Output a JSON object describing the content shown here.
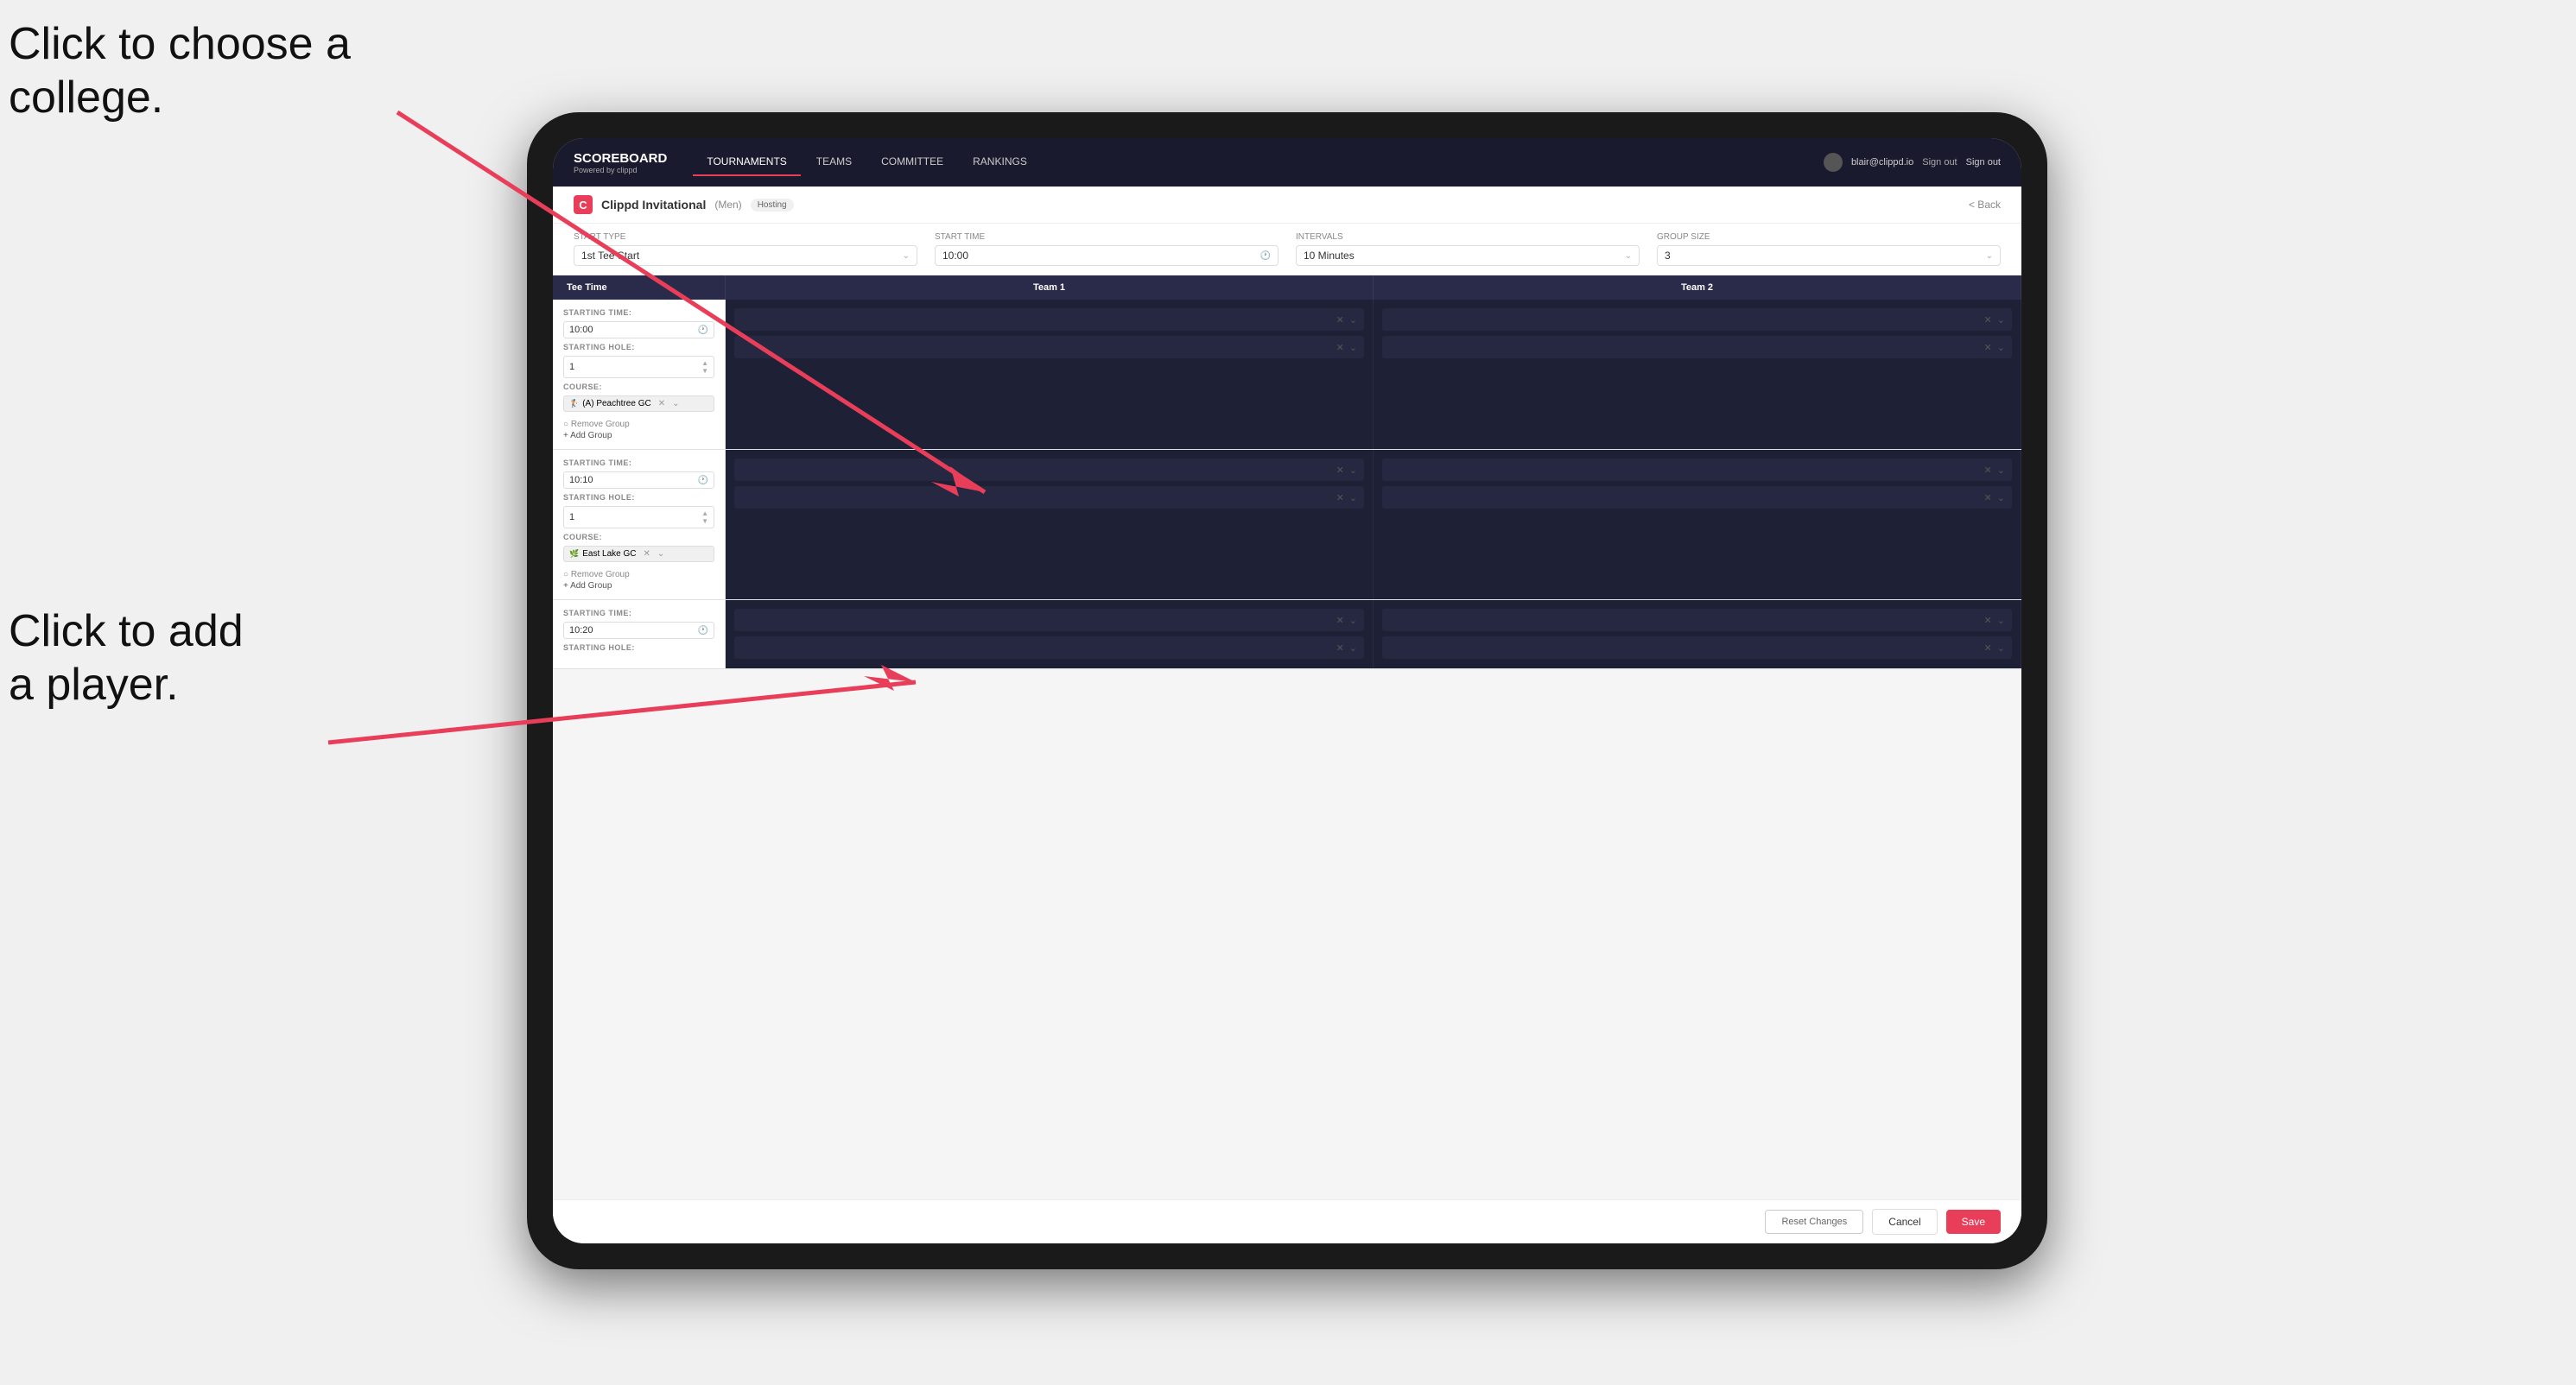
{
  "annotations": {
    "top": "Click to choose a\ncollege.",
    "bottom": "Click to add\na player."
  },
  "nav": {
    "logo": "SCOREBOARD",
    "powered_by": "Powered by clippd",
    "tabs": [
      {
        "label": "TOURNAMENTS",
        "active": true
      },
      {
        "label": "TEAMS",
        "active": false
      },
      {
        "label": "COMMITTEE",
        "active": false
      },
      {
        "label": "RANKINGS",
        "active": false
      }
    ],
    "user_email": "blair@clippd.io",
    "sign_out": "Sign out"
  },
  "page": {
    "tournament_name": "Clippd Invitational",
    "gender": "(Men)",
    "hosting_label": "Hosting",
    "back_label": "< Back"
  },
  "controls": {
    "start_type_label": "Start Type",
    "start_type_value": "1st Tee Start",
    "start_time_label": "Start Time",
    "start_time_value": "10:00",
    "intervals_label": "Intervals",
    "intervals_value": "10 Minutes",
    "group_size_label": "Group Size",
    "group_size_value": "3"
  },
  "table": {
    "tee_time_header": "Tee Time",
    "team1_header": "Team 1",
    "team2_header": "Team 2"
  },
  "groups": [
    {
      "starting_time": "10:00",
      "starting_hole": "1",
      "course": "(A) Peachtree GC",
      "course_icon": "🏌",
      "team1_players": 2,
      "team2_players": 2
    },
    {
      "starting_time": "10:10",
      "starting_hole": "1",
      "course": "East Lake GC",
      "course_icon": "🌿",
      "team1_players": 2,
      "team2_players": 2
    },
    {
      "starting_time": "10:20",
      "starting_hole": "",
      "course": "",
      "course_icon": "",
      "team1_players": 2,
      "team2_players": 2
    }
  ],
  "footer": {
    "reset_label": "Reset Changes",
    "cancel_label": "Cancel",
    "save_label": "Save"
  }
}
